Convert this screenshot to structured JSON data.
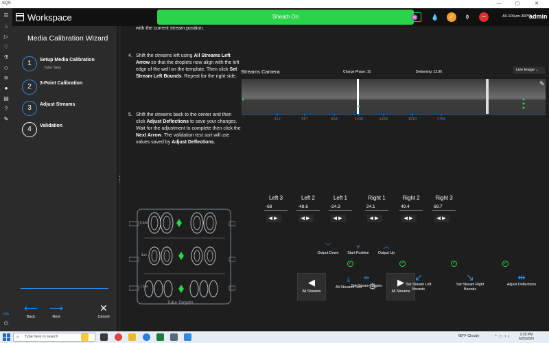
{
  "os": {
    "app_name": "SQS",
    "minimize": "—",
    "maximize": "▢",
    "close": "✕"
  },
  "rail": {
    "icons": [
      "menu-icon",
      "home-icon",
      "play-icon",
      "heart-icon",
      "flask-icon",
      "drop-icon",
      "layers-icon",
      "user-icon",
      "help-icon",
      "settings-icon",
      "info-icon",
      "power-icon"
    ],
    "info_label": "Info"
  },
  "header": {
    "title": "Workspace",
    "sheath_status": "Sheath On",
    "nozzle": "A0-100µm-30PSI",
    "user": "admin",
    "icon_colors": {
      "heartbeat": "#2bd34a",
      "gauge": "#f0a030",
      "stop": "#e03030"
    }
  },
  "wizard": {
    "title": "Media Calibration Wizard",
    "steps": [
      {
        "number": "1",
        "label": "Setup Media Calibration",
        "sub": "Tube Sets"
      },
      {
        "number": "2",
        "label": "3-Point Calibration"
      },
      {
        "number": "3",
        "label": "Adjust Streams"
      },
      {
        "number": "4",
        "label": "Validation"
      }
    ],
    "back_label": "Back",
    "next_label": "Next",
    "cancel_label": "Cancel"
  },
  "instructions": {
    "partial_top": "with the current stream position.",
    "step4_num": "4.",
    "step4": {
      "a": "Shift the streams left using ",
      "b": "All Streams Left Arrow",
      "c": " so that the droplets now align with the left edge of the well on the template. Then click ",
      "d": "Set Stream Left Bounds",
      "e": ". Repeat for the right side."
    },
    "step5_num": "5.",
    "step5": {
      "a": "Shift the streams back to the center and then click ",
      "b": "Adjust Deflections",
      "c": " to save your changes. Wait for the adjustment to complete then click the ",
      "d": "Next Arrow",
      "e": ". The validation test sort will use values saved by ",
      "f": "Adjust Deflections",
      "g": "."
    }
  },
  "camera": {
    "title": "Streams Camera",
    "charge_phase": "Charge Phase: 10",
    "defanning": "Defanning: 12.96",
    "mode": "Live Image",
    "ticks": [
      "312",
      "557",
      "818",
      "1036",
      "1256",
      "1510",
      "1766"
    ]
  },
  "streams": [
    {
      "label": "Left 3",
      "value": "-68"
    },
    {
      "label": "Left 2",
      "value": "-48.6"
    },
    {
      "label": "Left 1",
      "value": "-24.3"
    },
    {
      "label": "Right 1",
      "value": "24.1"
    },
    {
      "label": "Right 2",
      "value": "49.4"
    },
    {
      "label": "Right 3",
      "value": "69.7"
    }
  ],
  "controls": {
    "output_down": "Output Down",
    "start_position": "Start Position",
    "output_up": "Output Up",
    "all_streams_left": "All Streams",
    "all_streams_test": "All Streams Test",
    "set_stream_targets": "Set Stream Targets",
    "all_streams_right": "All Streams",
    "set_left_bounds": "Set Stream Left Bounds",
    "set_right_bounds": "Set Stream Right Bounds",
    "adjust_deflections": "Adjust Deflections"
  },
  "tube_targets": {
    "caption": "Tube Targets",
    "row_labels": [
      "0.2ml",
      "5ml",
      "1.5ml"
    ]
  },
  "taskbar": {
    "search_placeholder": "Type here to search",
    "weather": "68°F  Cloudy",
    "time": "2:20 PM",
    "date": "6/26/2025"
  }
}
